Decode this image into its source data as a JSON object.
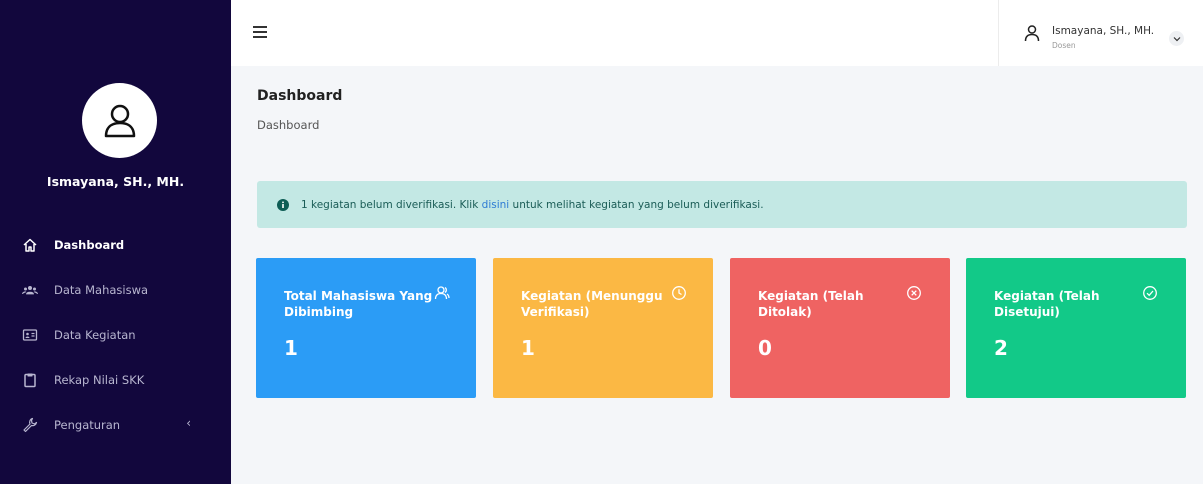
{
  "sidebar": {
    "user_name": "Ismayana, SH., MH.",
    "items": [
      {
        "label": "Dashboard",
        "icon": "home-icon"
      },
      {
        "label": "Data Mahasiswa",
        "icon": "users-icon"
      },
      {
        "label": "Data Kegiatan",
        "icon": "id-card-icon"
      },
      {
        "label": "Rekap Nilai SKK",
        "icon": "clipboard-icon"
      },
      {
        "label": "Pengaturan",
        "icon": "wrench-icon"
      }
    ],
    "colors": {
      "background": "#12073d"
    }
  },
  "topbar": {
    "user_name": "Ismayana, SH., MH.",
    "user_role": "Dosen"
  },
  "main": {
    "title": "Dashboard",
    "breadcrumb": "Dashboard",
    "alert": {
      "before": "1 kegiatan belum diverifikasi. Klik ",
      "link": "disini",
      "after": " untuk melihat kegiatan yang belum diverifikasi."
    },
    "cards": [
      {
        "title": "Total Mahasiswa Yang Dibimbing",
        "value": "1",
        "color": "#2b9cf6",
        "icon": "user-group-icon"
      },
      {
        "title": "Kegiatan (Menunggu Verifikasi)",
        "value": "1",
        "color": "#fbb844",
        "icon": "clock-icon"
      },
      {
        "title": "Kegiatan (Telah Ditolak)",
        "value": "0",
        "color": "#ef6362",
        "icon": "x-circle-icon"
      },
      {
        "title": "Kegiatan (Telah Disetujui)",
        "value": "2",
        "color": "#12c988",
        "icon": "check-circle-icon"
      }
    ]
  }
}
